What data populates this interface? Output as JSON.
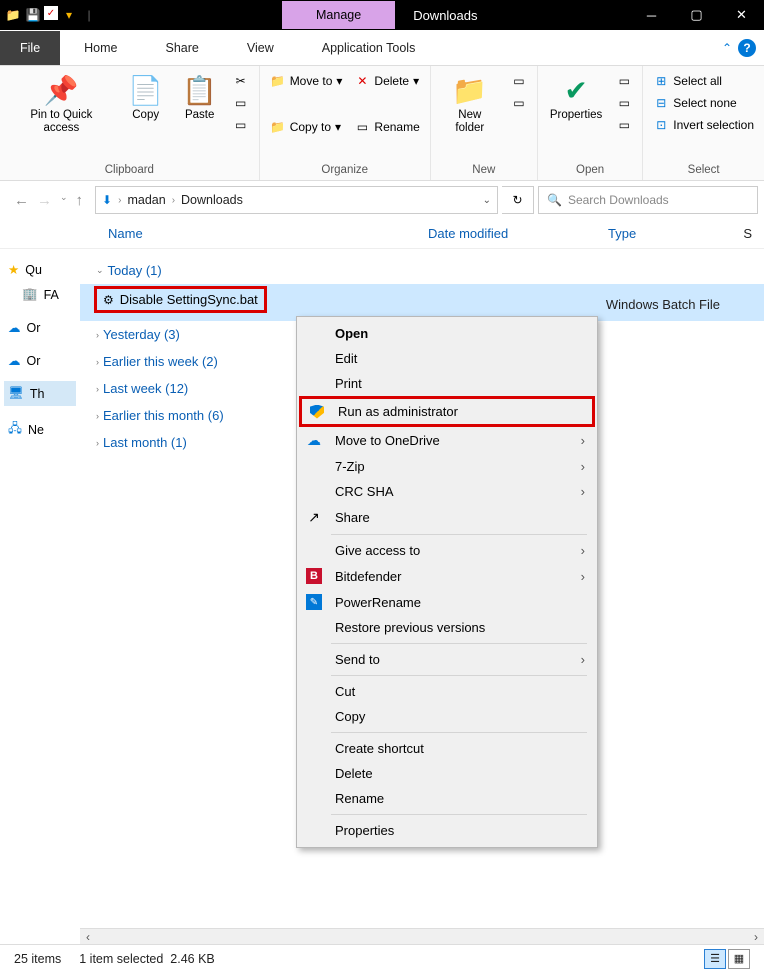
{
  "title": {
    "manage": "Manage",
    "downloads": "Downloads"
  },
  "tabs": {
    "file": "File",
    "home": "Home",
    "share": "Share",
    "view": "View",
    "apptools": "Application Tools"
  },
  "ribbon": {
    "clipboard": {
      "label": "Clipboard",
      "pin": "Pin to Quick access",
      "copy": "Copy",
      "paste": "Paste"
    },
    "organize": {
      "label": "Organize",
      "moveto": "Move to",
      "copyto": "Copy to",
      "delete": "Delete",
      "rename": "Rename"
    },
    "new": {
      "label": "New",
      "newfolder": "New folder"
    },
    "open": {
      "label": "Open",
      "properties": "Properties"
    },
    "select": {
      "label": "Select",
      "selectall": "Select all",
      "selectnone": "Select none",
      "invert": "Invert selection"
    }
  },
  "path": {
    "seg1": "madan",
    "seg2": "Downloads"
  },
  "search": {
    "placeholder": "Search Downloads"
  },
  "columns": {
    "name": "Name",
    "date": "Date modified",
    "type": "Type",
    "s": "S"
  },
  "sidebar": {
    "items": [
      {
        "label": "Qu"
      },
      {
        "label": "FA"
      },
      {
        "label": "Or"
      },
      {
        "label": "Or"
      },
      {
        "label": "Th"
      },
      {
        "label": "Ne"
      }
    ]
  },
  "groups": {
    "today": "Today (1)",
    "yesterday": "Yesterday (3)",
    "earlierweek": "Earlier this week (2)",
    "lastweek": "Last week (12)",
    "earliermonth": "Earlier this month (6)",
    "lastmonth": "Last month (1)"
  },
  "file": {
    "name": "Disable SettingSync.bat",
    "type": "Windows Batch File"
  },
  "ctx": {
    "open": "Open",
    "edit": "Edit",
    "print": "Print",
    "runadmin": "Run as administrator",
    "onedrive": "Move to OneDrive",
    "sevenzip": "7-Zip",
    "crcsha": "CRC SHA",
    "share": "Share",
    "giveaccess": "Give access to",
    "bitdefender": "Bitdefender",
    "powerrename": "PowerRename",
    "restore": "Restore previous versions",
    "sendto": "Send to",
    "cut": "Cut",
    "copy": "Copy",
    "shortcut": "Create shortcut",
    "delete": "Delete",
    "rename": "Rename",
    "properties": "Properties"
  },
  "status": {
    "items": "25 items",
    "selected": "1 item selected",
    "size": "2.46 KB"
  }
}
